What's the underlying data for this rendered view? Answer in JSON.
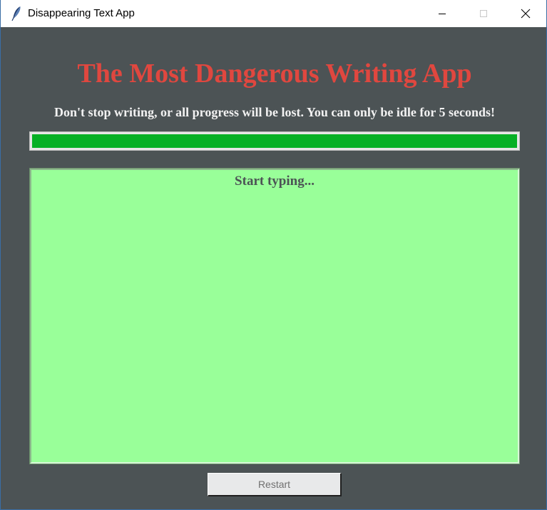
{
  "window": {
    "title": "Disappearing Text App",
    "icon": "feather-icon",
    "controls": {
      "minimize_icon": "minimize-icon",
      "maximize_icon": "maximize-icon",
      "close_icon": "close-icon"
    }
  },
  "app": {
    "title": "The Most Dangerous Writing App",
    "subtitle": "Don't stop writing, or all progress will be lost. You can only be idle for 5 seconds!",
    "progress": {
      "value_percent": 100,
      "color": "#06b025"
    },
    "text_area": {
      "content": "Start typing..."
    },
    "restart_label": "Restart"
  },
  "colors": {
    "background": "#4c5355",
    "title": "#e0473f",
    "subtitle": "#f2f2f2",
    "text_area_bg": "#99ff99",
    "progress_fill": "#06b025"
  }
}
